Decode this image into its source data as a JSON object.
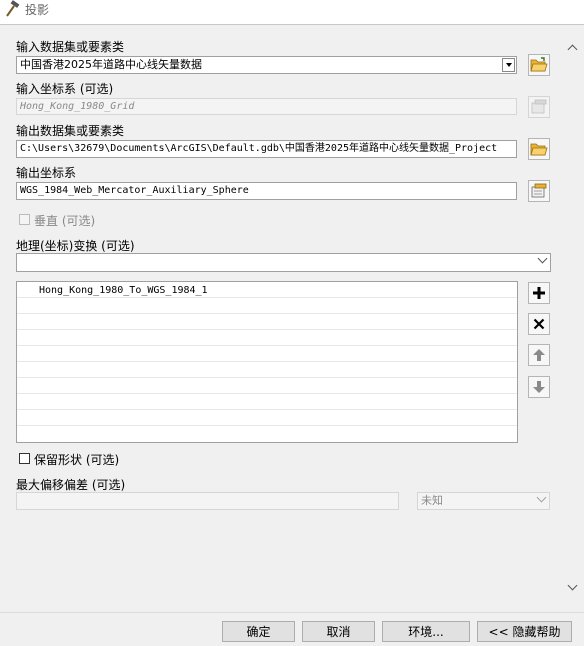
{
  "window": {
    "title": "投影",
    "icon": "hammer-icon"
  },
  "fields": {
    "input_dataset": {
      "label": "输入数据集或要素类",
      "value": "中国香港2025年道路中心线矢量数据"
    },
    "input_crs": {
      "label": "输入坐标系 (可选)",
      "value": "Hong_Kong_1980_Grid"
    },
    "output_dataset": {
      "label": "输出数据集或要素类",
      "value": "C:\\Users\\32679\\Documents\\ArcGIS\\Default.gdb\\中国香港2025年道路中心线矢量数据_Project"
    },
    "output_crs": {
      "label": "输出坐标系",
      "value": "WGS_1984_Web_Mercator_Auxiliary_Sphere"
    },
    "vertical": {
      "label": "垂直 (可选)",
      "checked": false,
      "enabled": false
    },
    "geo_transform": {
      "label": "地理(坐标)变换 (可选)",
      "value": "",
      "items": [
        "Hong_Kong_1980_To_WGS_1984_1"
      ]
    },
    "preserve_shape": {
      "label": "保留形状 (可选)",
      "checked": false
    },
    "max_offset": {
      "label": "最大偏移偏差 (可选)",
      "value": "",
      "unit": "未知"
    }
  },
  "buttons": {
    "ok": "确定",
    "cancel": "取消",
    "environments": "环境...",
    "hide_help": "<< 隐藏帮助"
  }
}
